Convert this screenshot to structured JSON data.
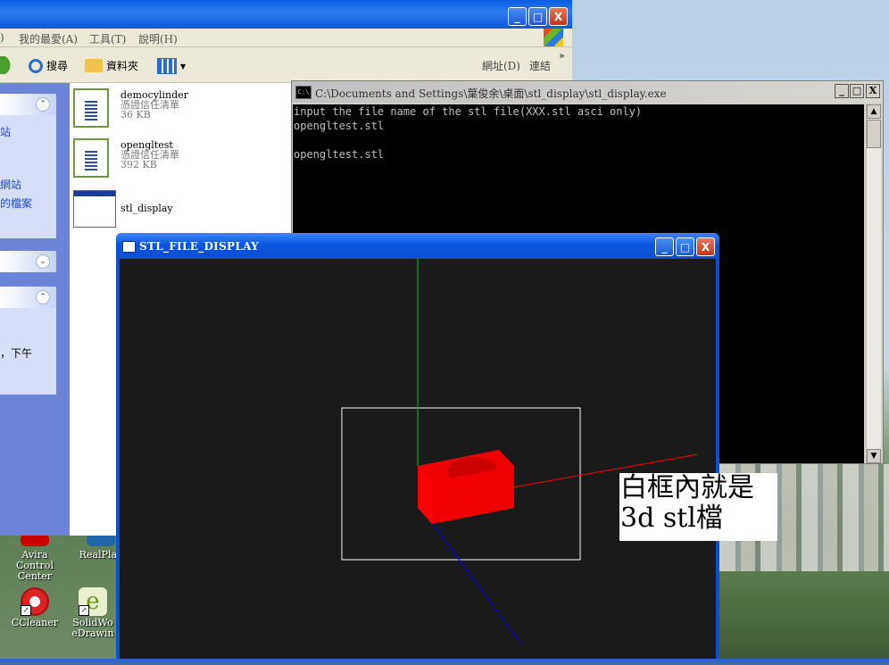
{
  "explorer": {
    "menu": [
      ")",
      "我的最愛(A)",
      "工具(T)",
      "說明(H)"
    ],
    "toolbar": {
      "search": "搜尋",
      "folders": "資料夾",
      "address": "網址(D)",
      "links": "連結",
      "more": "»"
    },
    "taskpane": {
      "link1": "站",
      "link2": "網站",
      "link3": "的檔案",
      "details": "，下午"
    },
    "files": [
      {
        "name": "democylinder",
        "type": "憑證信任清單",
        "size": "36 KB"
      },
      {
        "name": "opengltest",
        "type": "憑證信任清單",
        "size": "392 KB"
      },
      {
        "name": "stl_display"
      }
    ]
  },
  "console": {
    "title": "C:\\Documents and Settings\\葉俊余\\桌面\\stl_display\\stl_display.exe",
    "icon_text": "C:\\",
    "lines": [
      "input the file name of the stl file(XXX.stl asci only)",
      "opengltest.stl",
      "",
      "opengltest.stl"
    ]
  },
  "stl_window": {
    "title": "STL_FILE_DISPLAY"
  },
  "annotation": {
    "line1": "白框內就是",
    "line2": "3d stl檔"
  },
  "desktop_icons": [
    {
      "label": "Avira Control Center"
    },
    {
      "label": "RealPlay"
    },
    {
      "label": "CCleaner"
    },
    {
      "label": "SolidWo eDrawin"
    }
  ],
  "buttons": {
    "minimize": "_",
    "maximize": "□",
    "close": "X"
  },
  "colors": {
    "axis_x": "#ff0000",
    "axis_y": "#00cc00",
    "axis_z": "#0000ff",
    "model": "#ff0000",
    "bbox": "#ffffff"
  }
}
